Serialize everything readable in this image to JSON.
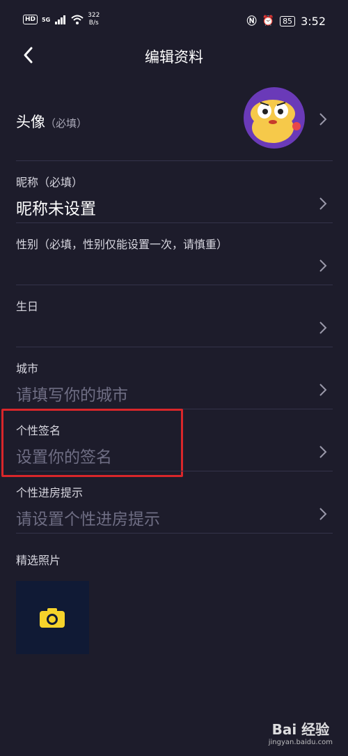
{
  "status_bar": {
    "hd": "HD",
    "network": "5G",
    "speed": "322\nB/s",
    "battery": "85",
    "time": "3:52"
  },
  "header": {
    "title": "编辑资料"
  },
  "fields": {
    "avatar": {
      "label": "头像",
      "required": "（必填）"
    },
    "nickname": {
      "label": "昵称（必填）",
      "value": "昵称未设置"
    },
    "gender": {
      "label": "性别（必填，性别仅能设置一次，请慎重）",
      "value": ""
    },
    "birthday": {
      "label": "生日",
      "value": ""
    },
    "city": {
      "label": "城市",
      "placeholder": "请填写你的城市"
    },
    "signature": {
      "label": "个性签名",
      "placeholder": "设置你的签名"
    },
    "entry_hint": {
      "label": "个性进房提示",
      "placeholder": "请设置个性进房提示"
    }
  },
  "photos": {
    "label": "精选照片"
  },
  "watermark": {
    "logo": "Bai 经验",
    "url": "jingyan.baidu.com"
  },
  "colors": {
    "background": "#1d1c2b",
    "placeholder": "#6f6e84",
    "highlight": "#d9262a",
    "camera": "#f6d32b"
  },
  "icons": [
    "back-arrow-icon",
    "chevron-right-icon",
    "camera-icon",
    "wifi-icon",
    "signal-icon",
    "nfc-icon",
    "alarm-icon"
  ]
}
